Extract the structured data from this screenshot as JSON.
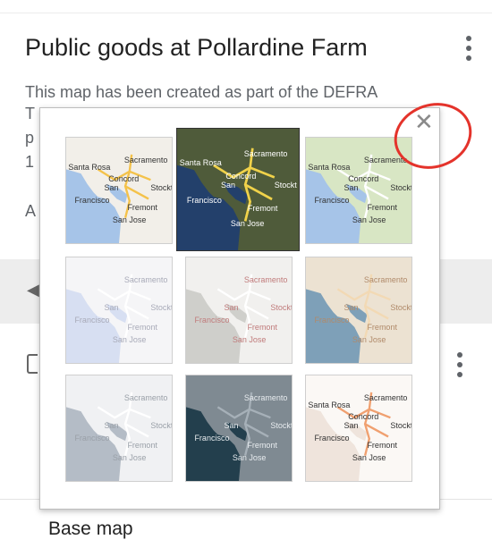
{
  "panel": {
    "title": "Public goods at Pollardine Farm",
    "description_line": "This map has been created as part of the DEFRA",
    "fragments": [
      "T",
      "p",
      "1",
      "A"
    ],
    "section_label": "Base map"
  },
  "dialog": {
    "close_label": "✕",
    "tiles": [
      {
        "name": "map",
        "labels": [
          "Sacramento",
          "Santa Rosa",
          "San",
          "Francisco",
          "Concord",
          "Stockt",
          "Fremont",
          "San Jose"
        ]
      },
      {
        "name": "satellite",
        "labels": [
          "Sacramento",
          "Santa Rosa",
          "San",
          "Francisco",
          "Concord",
          "Stockt",
          "Fremont",
          "San Jose"
        ]
      },
      {
        "name": "terrain",
        "labels": [
          "Sacramento",
          "Santa Rosa",
          "San",
          "Francisco",
          "Concord",
          "Stockt",
          "Fremont",
          "San Jose"
        ]
      },
      {
        "name": "light",
        "labels": [
          "Sacramento",
          "San",
          "Francisco",
          "Stockt",
          "Fremont",
          "San Jose"
        ]
      },
      {
        "name": "mono",
        "labels": [
          "Sacramento",
          "San",
          "Francisco",
          "Stockt",
          "Fremont",
          "San Jose"
        ]
      },
      {
        "name": "beige",
        "labels": [
          "Sacramento",
          "San",
          "Francisco",
          "Stockt",
          "Fremont",
          "San Jose"
        ]
      },
      {
        "name": "grey",
        "labels": [
          "Sacramento",
          "San",
          "Francisco",
          "Stockt",
          "Fremont",
          "San Jose"
        ]
      },
      {
        "name": "dark",
        "labels": [
          "Sacramento",
          "San",
          "Francisco",
          "Stockt",
          "Fremont",
          "San Jose"
        ]
      },
      {
        "name": "outline",
        "labels": [
          "Sacramento",
          "Santa Rosa",
          "San",
          "Francisco",
          "Concord",
          "Stockt",
          "Fremont",
          "San Jose"
        ]
      }
    ]
  },
  "colors": {
    "annotation_circle": "#e4332b",
    "map": {
      "land": "#f2efe9",
      "water": "#a6c4e8",
      "road": "#f4c24a",
      "text": "#333"
    },
    "satellite": {
      "land": "#4f5b3a",
      "water": "#23406b",
      "road": "#f0d24a",
      "text": "#ffffff"
    },
    "terrain": {
      "land": "#d8e6c4",
      "water": "#a6c4e8",
      "road": "#ffffff",
      "text": "#333"
    },
    "light": {
      "land": "#f5f5f7",
      "water": "#d7dff2",
      "road": "#ffffff",
      "text": "#a8aab8"
    },
    "mono": {
      "land": "#f1f0ee",
      "water": "#cfcfcb",
      "road": "#ffffff",
      "text": "#c07b7b"
    },
    "beige": {
      "land": "#ece2d2",
      "water": "#7ea0b8",
      "road": "#f2d9b4",
      "text": "#b08a6a"
    },
    "grey": {
      "land": "#f0f1f3",
      "water": "#b4bcc6",
      "road": "#ffffff",
      "text": "#9aa0a8"
    },
    "dark": {
      "land": "#7f8a92",
      "water": "#233f4d",
      "road": "#a6b0b8",
      "text": "#e8ecef"
    },
    "outline": {
      "land": "#fbf8f5",
      "water": "#efe4dc",
      "road": "#f0a070",
      "text": "#333"
    }
  }
}
